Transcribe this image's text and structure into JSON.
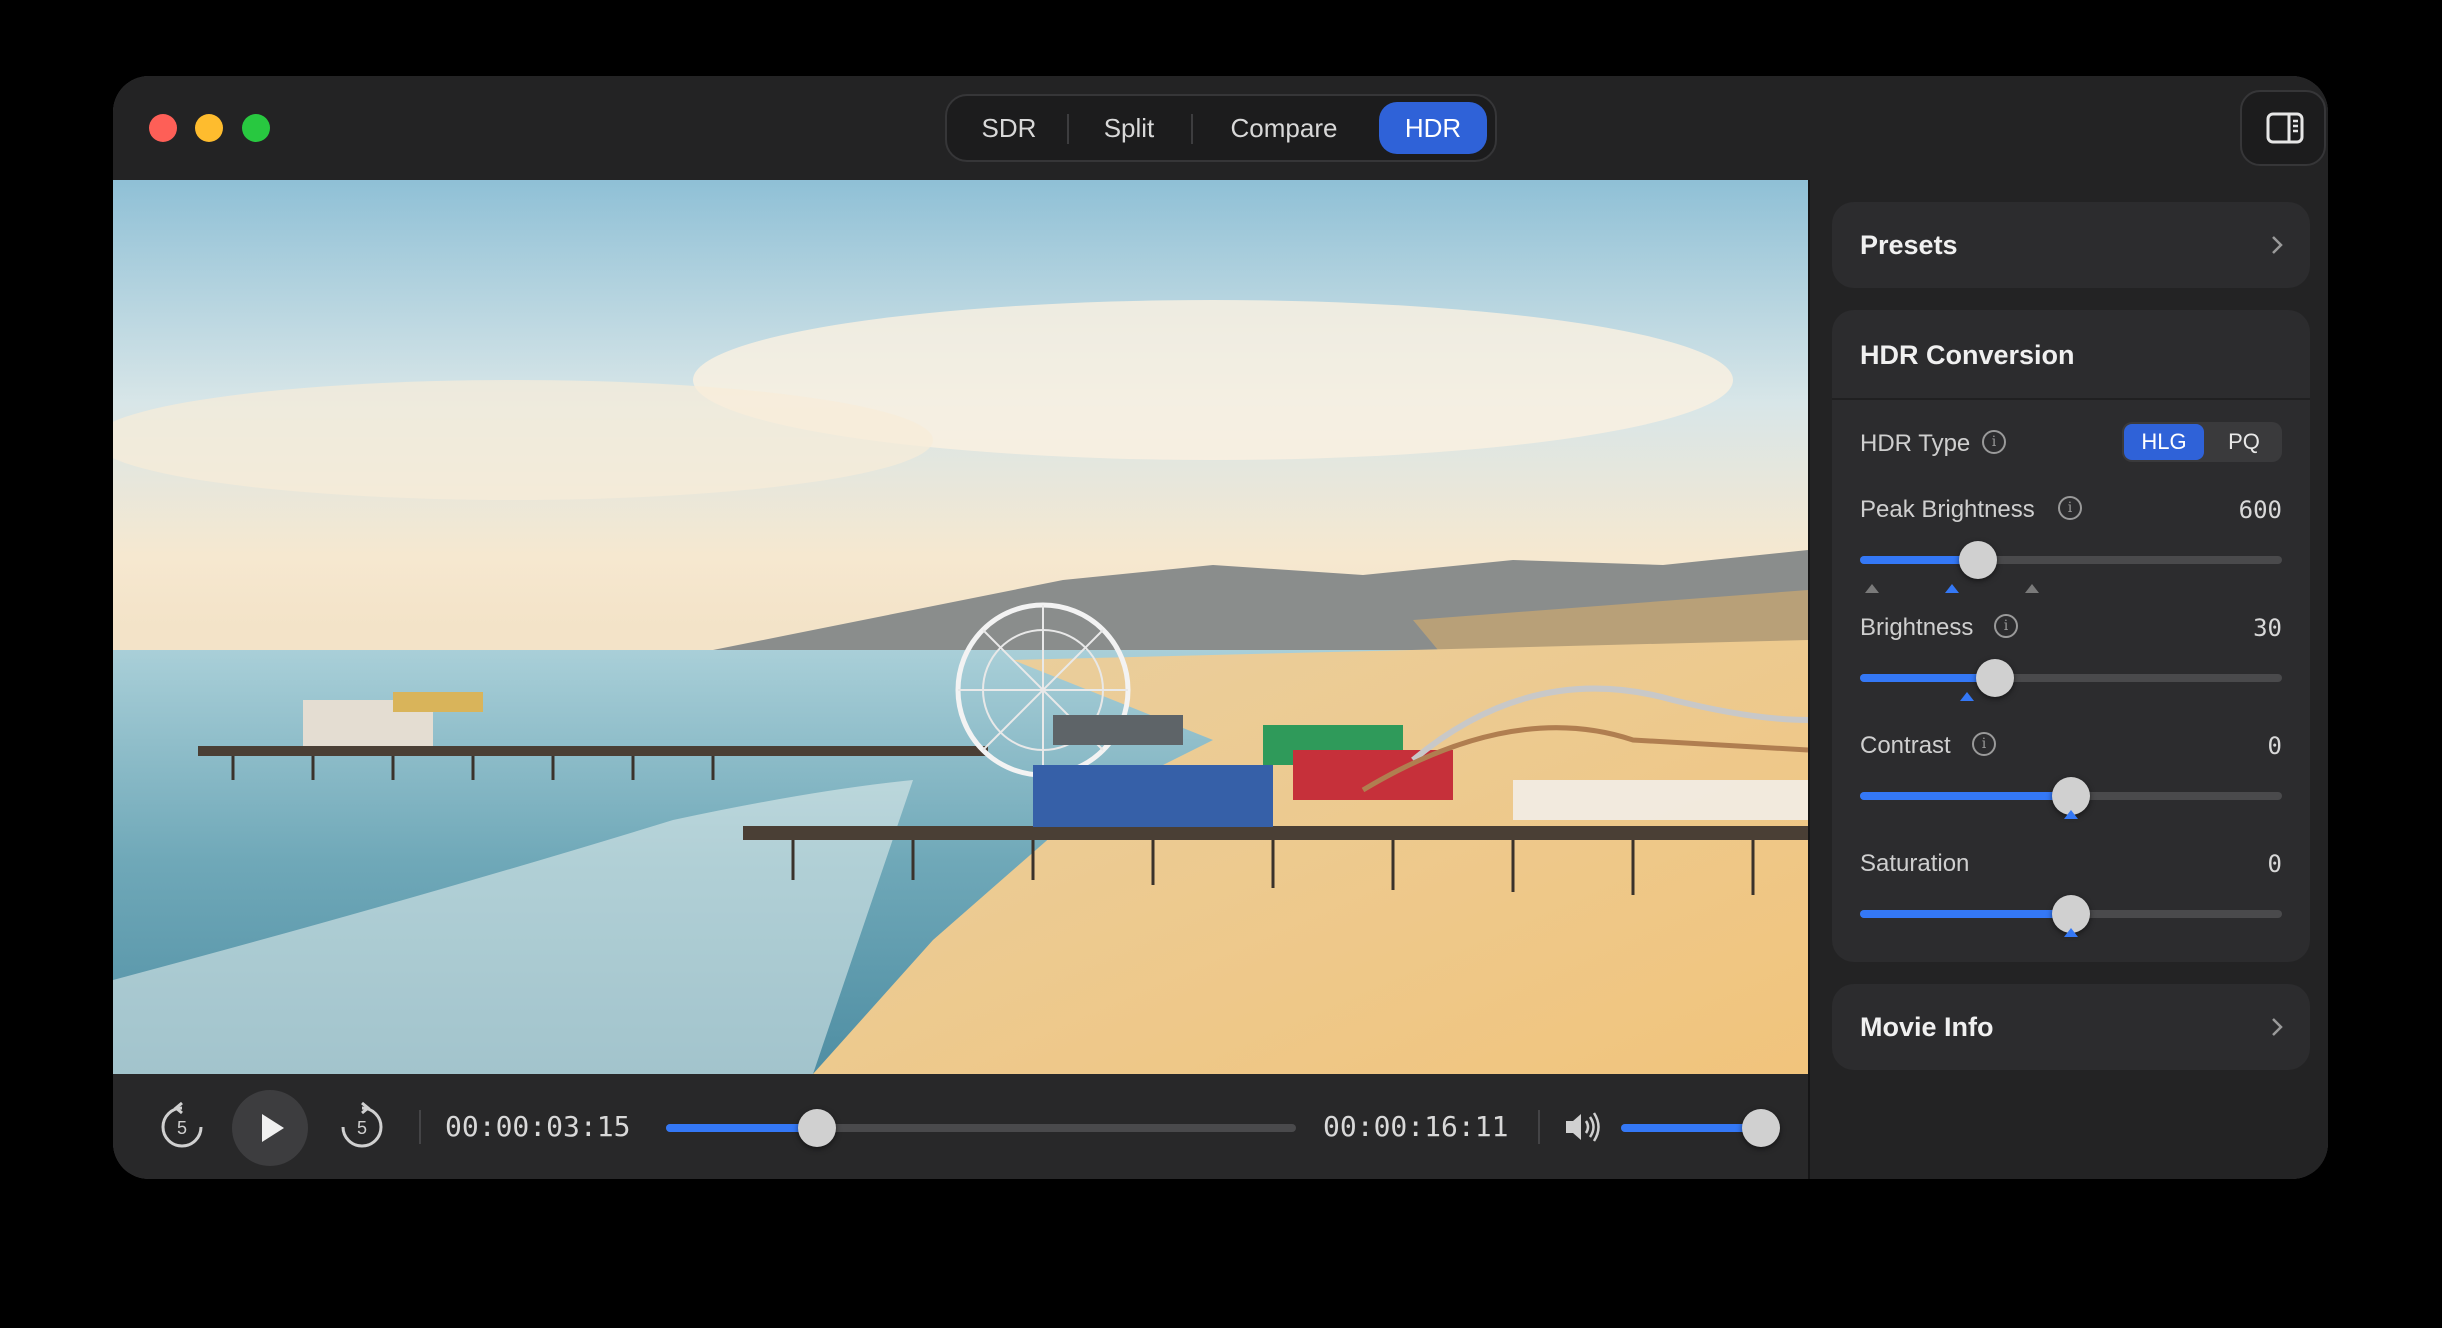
{
  "viewer_modes": {
    "items": [
      "SDR",
      "Split",
      "Compare",
      "HDR"
    ],
    "active": "HDR"
  },
  "playback": {
    "current_time": "00:00:03:15",
    "total_time": "00:00:16:11",
    "progress_fraction": 0.24,
    "volume_fraction": 1.0,
    "skip_back_seconds": "5",
    "skip_forward_seconds": "5"
  },
  "panel": {
    "presets": {
      "title": "Presets"
    },
    "hdr_conversion": {
      "title": "HDR Conversion",
      "hdr_type": {
        "label": "HDR Type",
        "options": [
          "HLG",
          "PQ"
        ],
        "selected": "HLG"
      },
      "peak_brightness": {
        "label": "Peak Brightness",
        "value": "600",
        "fraction": 0.28
      },
      "brightness": {
        "label": "Brightness",
        "value": "30",
        "fraction": 0.32
      },
      "contrast": {
        "label": "Contrast",
        "value": "0",
        "fraction": 0.5
      },
      "saturation": {
        "label": "Saturation",
        "value": "0",
        "fraction": 0.5
      }
    },
    "movie_info": {
      "title": "Movie Info"
    }
  },
  "colors": {
    "accent": "#3478f6",
    "segment_active": "#2f62d8",
    "traffic_red": "#fe5f57",
    "traffic_yellow": "#febc2e",
    "traffic_green": "#28c840"
  }
}
